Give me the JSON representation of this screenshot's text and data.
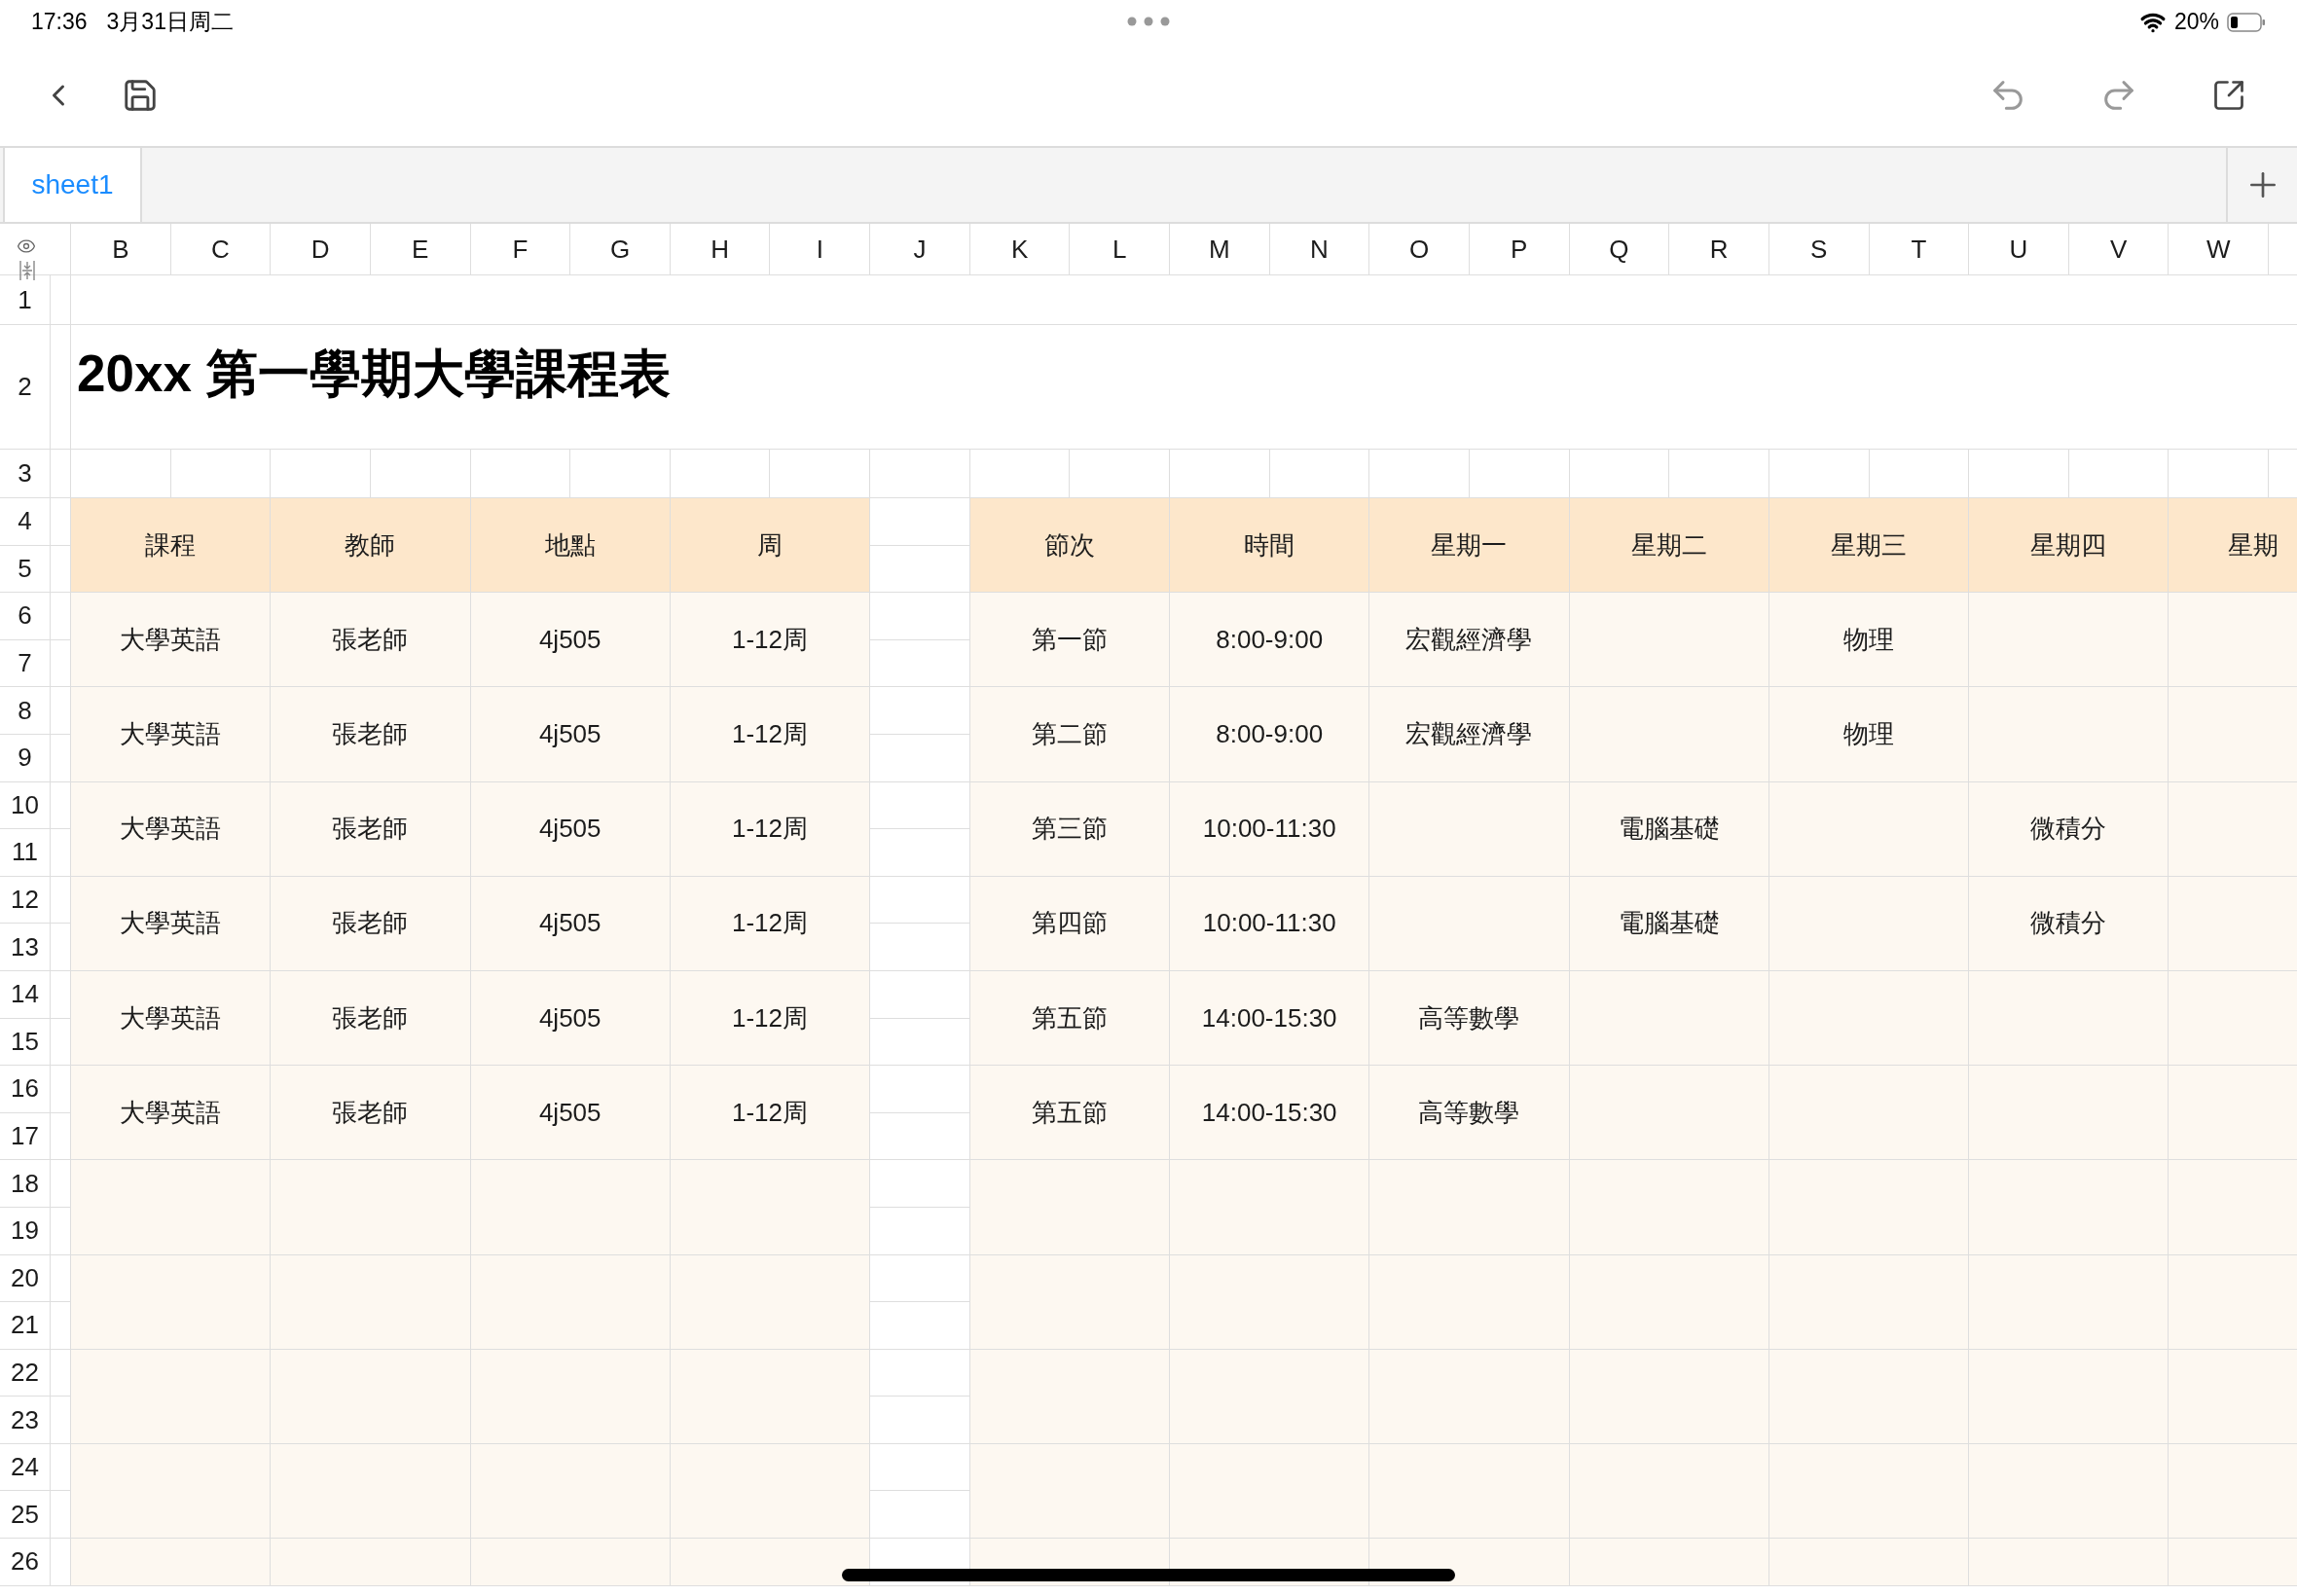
{
  "status_bar": {
    "time": "17:36",
    "date": "3月31日周二",
    "battery": "20%"
  },
  "sheet_tabs": [
    {
      "label": "sheet1",
      "selected": true
    }
  ],
  "column_headers": [
    "B",
    "C",
    "D",
    "E",
    "F",
    "G",
    "H",
    "I",
    "J",
    "K",
    "L",
    "M",
    "N",
    "O",
    "P",
    "Q",
    "R",
    "S",
    "T",
    "U",
    "V",
    "W"
  ],
  "row_headers": [
    "1",
    "2",
    "3",
    "4",
    "5",
    "6",
    "7",
    "8",
    "9",
    "10",
    "11",
    "12",
    "13",
    "14",
    "15",
    "16",
    "17",
    "18",
    "19",
    "20",
    "21",
    "22",
    "23",
    "24",
    "25",
    "26"
  ],
  "title": "20xx 第一學期大學課程表",
  "course_table": {
    "columns": [
      "課程",
      "教師",
      "地點",
      "周"
    ],
    "rows": [
      [
        "大學英語",
        "張老師",
        "4j505",
        "1-12周"
      ],
      [
        "大學英語",
        "張老師",
        "4j505",
        "1-12周"
      ],
      [
        "大學英語",
        "張老師",
        "4j505",
        "1-12周"
      ],
      [
        "大學英語",
        "張老師",
        "4j505",
        "1-12周"
      ],
      [
        "大學英語",
        "張老師",
        "4j505",
        "1-12周"
      ],
      [
        "大學英語",
        "張老師",
        "4j505",
        "1-12周"
      ]
    ]
  },
  "schedule_table": {
    "columns": [
      "節次",
      "時間",
      "星期一",
      "星期二",
      "星期三",
      "星期四",
      "星期"
    ],
    "rows": [
      {
        "period": "第一節",
        "time": "8:00-9:00",
        "mon": "宏觀經濟學",
        "wed": "物理"
      },
      {
        "period": "第二節",
        "time": "8:00-9:00",
        "mon": "宏觀經濟學",
        "wed": "物理"
      },
      {
        "period": "第三節",
        "time": "10:00-11:30",
        "tue": "電腦基礎",
        "thu": "微積分"
      },
      {
        "period": "第四節",
        "time": "10:00-11:30",
        "tue": "電腦基礎",
        "thu": "微積分"
      },
      {
        "period": "第五節",
        "time": "14:00-15:30",
        "mon": "高等數學"
      },
      {
        "period": "第五節",
        "time": "14:00-15:30",
        "mon": "高等數學"
      }
    ]
  }
}
